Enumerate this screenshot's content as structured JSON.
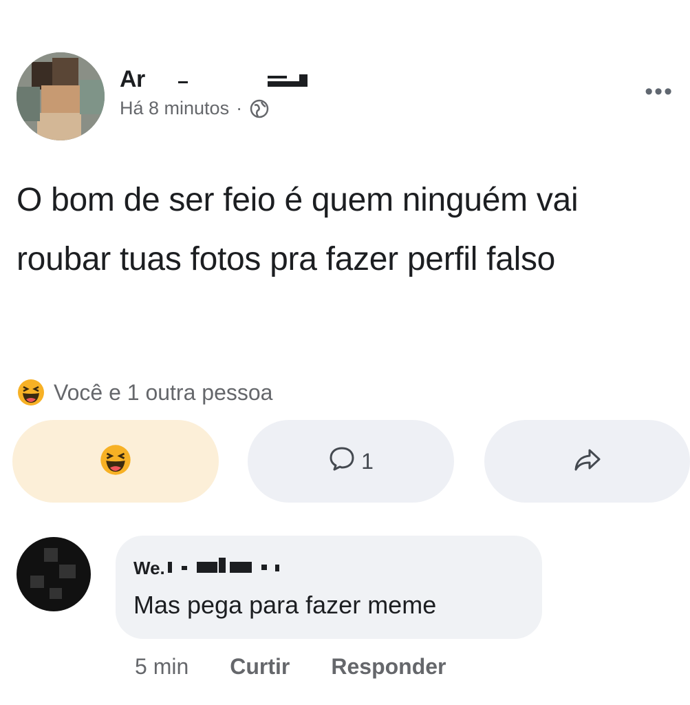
{
  "post": {
    "author_name": "Ar",
    "timestamp": "Há 8 minutos",
    "separator": "·",
    "privacy_icon": "globe-icon",
    "more_label": "•••",
    "text": "O bom de ser feio é quem ninguém vai roubar tuas fotos pra fazer perfil falso",
    "reaction_icon": "haha-emoji-icon",
    "reaction_summary": "Você e 1 outra pessoa"
  },
  "actions": {
    "react_icon": "haha-emoji-icon",
    "comment_icon": "comment-bubble-icon",
    "comment_count": "1",
    "share_icon": "share-arrow-icon"
  },
  "comment": {
    "author_name": "We.",
    "text": "Mas pega para fazer meme",
    "time": "5 min",
    "like_label": "Curtir",
    "reply_label": "Responder"
  },
  "colors": {
    "react_button_bg": "#fcefd8",
    "action_button_bg": "#eef0f5",
    "bubble_bg": "#f0f2f5",
    "meta_text": "#65676b",
    "haha_yellow": "#f7b125"
  }
}
